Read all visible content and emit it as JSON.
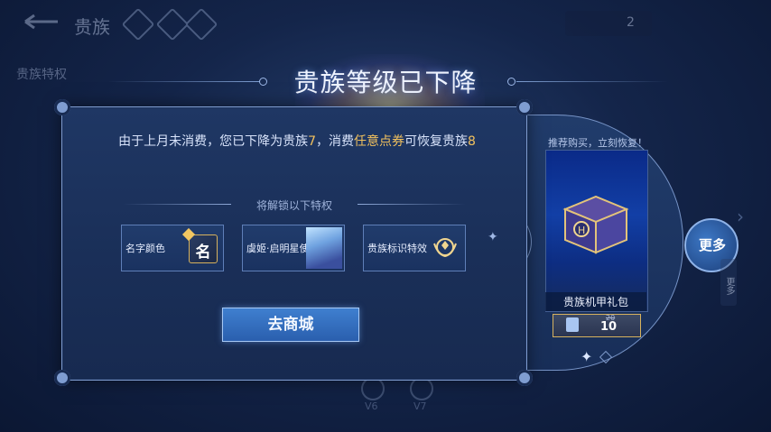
{
  "background": {
    "page_title": "贵族",
    "side_tabs": [
      "贵族特权"
    ],
    "top_right_count": "2",
    "bottom_labels": [
      "V6",
      "V7"
    ]
  },
  "dialog": {
    "title": "贵族等级已下降",
    "message_prefix": "由于上月未消费，您已下降为贵族",
    "current_level": "7",
    "message_mid": "，消费",
    "highlight_text": "任意点券",
    "message_suffix": "可恢复贵族",
    "restore_level": "8",
    "unlock_title": "将解锁以下特权",
    "perks": [
      {
        "label": "名字颜色",
        "icon": "name-color-icon",
        "icon_text": "名"
      },
      {
        "label": "虞姬·启明星使",
        "icon": "hero-skin-portrait"
      },
      {
        "label": "贵族标识特效",
        "icon": "noble-emblem-icon"
      }
    ],
    "shop_button": "去商城"
  },
  "recommend": {
    "title": "推荐购买，立刻恢复！",
    "item_name": "贵族机甲礼包",
    "old_price": "20",
    "price": "10",
    "more_button": "更多",
    "more_side": "更多"
  },
  "colors": {
    "accent_gold": "#f1c15e",
    "button_blue": "#3f7fcf",
    "panel_border": "#7f9dd1"
  }
}
